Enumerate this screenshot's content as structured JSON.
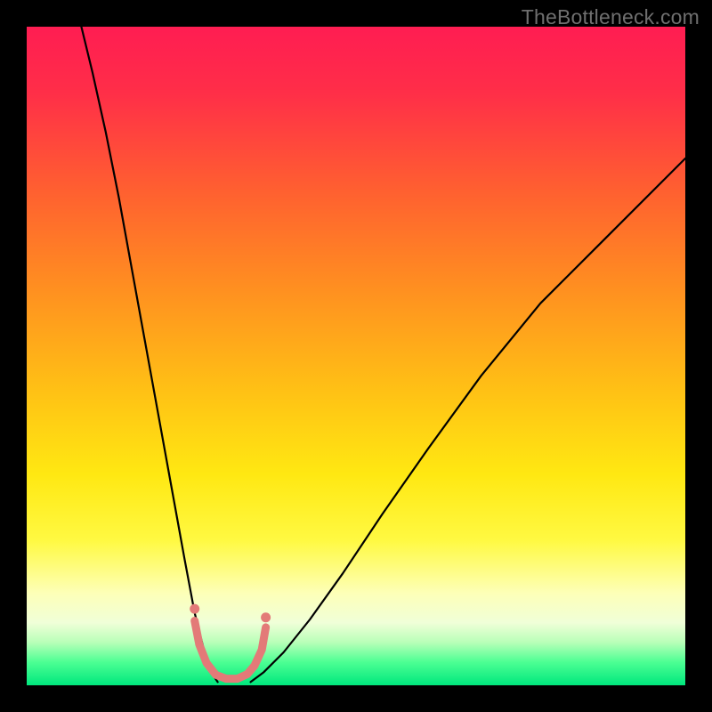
{
  "watermark": "TheBottleneck.com",
  "chart_data": {
    "type": "line",
    "title": "",
    "xlabel": "",
    "ylabel": "",
    "xlim": [
      0,
      100
    ],
    "ylim": [
      0,
      100
    ],
    "background_gradient": {
      "stops": [
        {
          "pos": 0.0,
          "color": "#ff1d52"
        },
        {
          "pos": 0.1,
          "color": "#ff2e48"
        },
        {
          "pos": 0.25,
          "color": "#ff6030"
        },
        {
          "pos": 0.4,
          "color": "#ff9020"
        },
        {
          "pos": 0.55,
          "color": "#ffc015"
        },
        {
          "pos": 0.68,
          "color": "#ffe812"
        },
        {
          "pos": 0.78,
          "color": "#fff942"
        },
        {
          "pos": 0.86,
          "color": "#fdffb8"
        },
        {
          "pos": 0.905,
          "color": "#f0ffd8"
        },
        {
          "pos": 0.935,
          "color": "#b8ffb8"
        },
        {
          "pos": 0.965,
          "color": "#4cff93"
        },
        {
          "pos": 1.0,
          "color": "#00e77d"
        }
      ]
    },
    "series": [
      {
        "name": "left-branch",
        "stroke": "#000000",
        "stroke_width": 2.2,
        "x": [
          8.3,
          10,
          12,
          14,
          16,
          18,
          20,
          22,
          24,
          25.5,
          27,
          28,
          29
        ],
        "y": [
          100,
          93,
          84,
          74,
          63,
          52,
          41,
          30,
          19,
          11,
          5,
          2,
          0.5
        ]
      },
      {
        "name": "right-branch",
        "stroke": "#000000",
        "stroke_width": 2.2,
        "x": [
          34,
          36,
          39,
          43,
          48,
          54,
          61,
          69,
          78,
          88,
          100
        ],
        "y": [
          0.5,
          2,
          5,
          10,
          17,
          26,
          36,
          47,
          58,
          68,
          80
        ]
      },
      {
        "name": "bottom-lobe",
        "stroke": "#e37a78",
        "stroke_width": 9,
        "x": [
          25.5,
          26.2,
          27.3,
          28.7,
          30.3,
          32.0,
          33.5,
          34.6,
          35.7,
          36.3
        ],
        "y": [
          9.8,
          6.2,
          3.4,
          1.6,
          1.0,
          1.0,
          1.7,
          3.0,
          5.4,
          8.8
        ]
      },
      {
        "name": "lobe-dot-left",
        "stroke": "#e37a78",
        "stroke_width": 11,
        "x": [
          25.5,
          25.5
        ],
        "y": [
          11.6,
          11.6
        ]
      },
      {
        "name": "lobe-dot-right",
        "stroke": "#e37a78",
        "stroke_width": 11,
        "x": [
          36.3,
          36.3
        ],
        "y": [
          10.3,
          10.3
        ]
      }
    ]
  }
}
